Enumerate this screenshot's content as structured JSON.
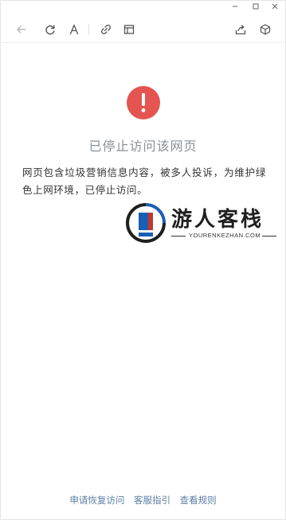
{
  "window": {
    "minimize_icon": "minimize-icon",
    "maximize_icon": "maximize-icon",
    "close_icon": "close-icon"
  },
  "toolbar": {
    "icons": [
      "back-arrow-icon",
      "refresh-icon",
      "font-size-icon",
      "link-icon",
      "reading-mode-icon",
      "share-icon",
      "cube-icon"
    ]
  },
  "colors": {
    "warning": "#e45450",
    "title": "#8a8f99",
    "link": "#5b7fa6",
    "logo_blue": "#1a5fb4"
  },
  "warning": {
    "mark": "!",
    "title": "已停止访问该网页",
    "description": "网页包含垃圾营销信息内容，被多人投诉，为维护绿色上网环境，已停止访问。"
  },
  "watermark": {
    "name": "游人客栈",
    "url": "YOURENKEZHAN.COM"
  },
  "footer": {
    "links": [
      "申请恢复访问",
      "客服指引",
      "查看规则"
    ]
  }
}
